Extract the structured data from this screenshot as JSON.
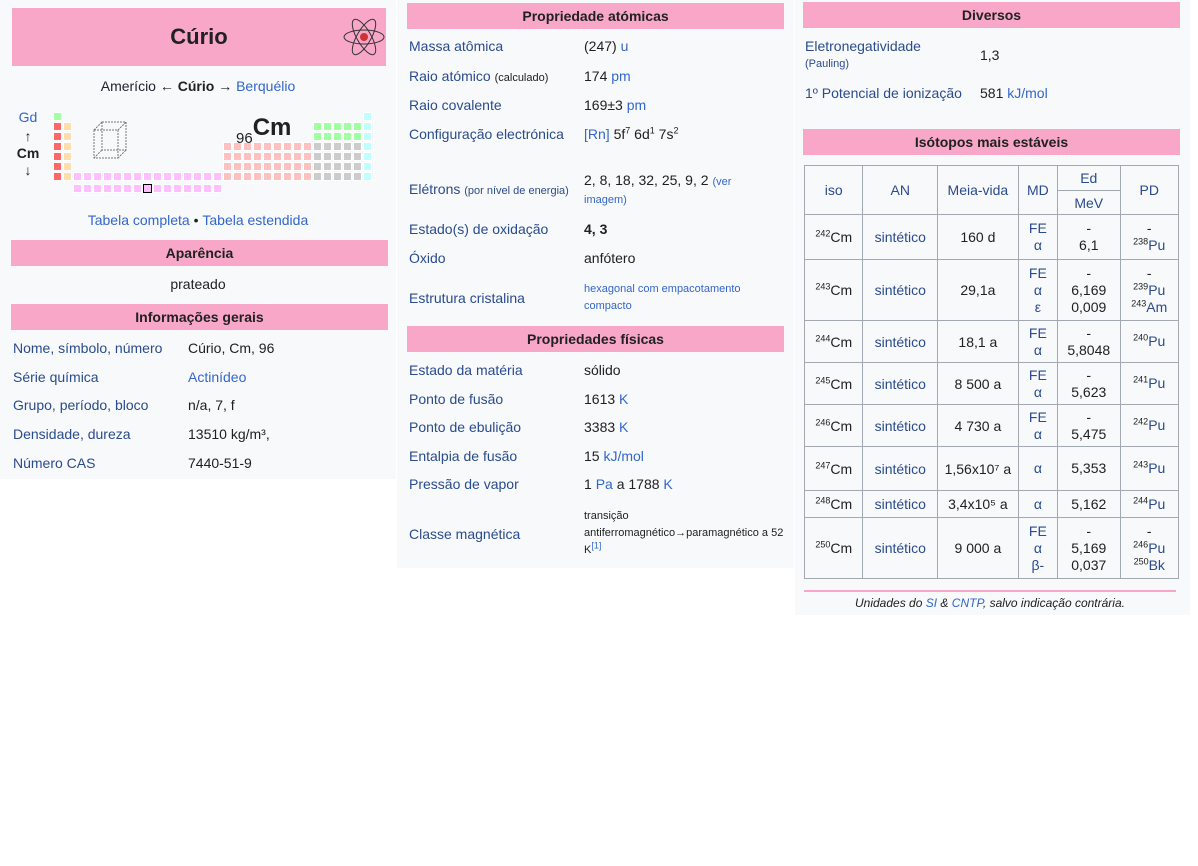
{
  "col1": {
    "title": "Cúrio",
    "nav": {
      "prev": "Amerício",
      "arrow_left": "←",
      "current": "Cúrio",
      "arrow_right": "→",
      "next": "Berquélio"
    },
    "vertical": {
      "above": "Gd",
      "up": "↑",
      "current": "Cm",
      "down": "↓"
    },
    "symbol_number": "96",
    "symbol": "Cm",
    "table_links": {
      "full": "Tabela completa",
      "sep": "•",
      "extended": "Tabela estendida"
    },
    "appearance_header": "Aparência",
    "appearance_value": "prateado",
    "general_header": "Informações gerais",
    "general": [
      {
        "label": "Nome, símbolo, número",
        "value": "Cúrio, Cm, 96"
      },
      {
        "label": "Série química",
        "value": "Actinídeo"
      },
      {
        "label": "Grupo, período, bloco",
        "value": "n/a, 7, f"
      },
      {
        "label": "Densidade, dureza",
        "value": "13510 kg/m³,"
      },
      {
        "label": "Número CAS",
        "value": "7440-51-9"
      }
    ]
  },
  "col2": {
    "atomic_header": "Propriedade atómicas",
    "atomic": {
      "mass_label": "Massa atômica",
      "mass_value": "(247)",
      "mass_unit": "u",
      "radius_label": "Raio atómico",
      "radius_small": "(calculado)",
      "radius_value": "174",
      "radius_unit": "pm",
      "cov_label": "Raio covalente",
      "cov_value": "169±3",
      "cov_unit": "pm",
      "config_label": "Configuração electrónica",
      "config_rn": "[Rn]",
      "electrons_label": "Elétrons",
      "electrons_small": "(por nível de energia)",
      "electrons_value": "2, 8, 18, 32, 25, 9, 2",
      "electrons_link": "(ver imagem)",
      "ox_label": "Estado(s) de oxidação",
      "ox_value": "4, 3",
      "oxide_label": "Óxido",
      "oxide_value": "anfótero",
      "crystal_label": "Estrutura cristalina",
      "crystal_value": "hexagonal com empacotamento compacto"
    },
    "physical_header": "Propriedades físicas",
    "physical": {
      "state_label": "Estado da matéria",
      "state_value": "sólido",
      "melt_label": "Ponto de fusão",
      "melt_value": "1613",
      "melt_unit": "K",
      "boil_label": "Ponto de ebulição",
      "boil_value": "3383",
      "boil_unit": "K",
      "enth_label": "Entalpia de fusão",
      "enth_value": "15",
      "enth_unit": "kJ/mol",
      "vap_label": "Pressão de vapor",
      "vap_value": "1",
      "vap_unit": "Pa",
      "vap_at": "a 1788",
      "vap_unit2": "K",
      "mag_label": "Classe magnética",
      "mag_value": "transição antiferromagnético→paramagnético a 52 K",
      "mag_ref": "[1]"
    }
  },
  "col3": {
    "misc_header": "Diversos",
    "eneg_label": "Eletronegatividade",
    "eneg_small": "(Pauling)",
    "eneg_value": "1,3",
    "ion_label": "1º Potencial de ionização",
    "ion_value": "581",
    "ion_unit": "kJ/mol",
    "iso_header": "Isótopos mais estáveis",
    "cols": {
      "iso": "iso",
      "an": "AN",
      "half": "Meia-vida",
      "md": "MD",
      "ed": "Ed",
      "mev": "MeV",
      "pd": "PD"
    },
    "isotopes": [
      {
        "mass": "242",
        "el": "Cm",
        "an": "sintético",
        "half": "160 d",
        "md": [
          "FE",
          "α"
        ],
        "ed": [
          "-",
          "6,1"
        ],
        "pd": [
          [
            "",
            "-"
          ],
          [
            "238",
            "Pu"
          ]
        ]
      },
      {
        "mass": "243",
        "el": "Cm",
        "an": "sintético",
        "half": "29,1a",
        "md": [
          "FE",
          "α",
          "ε"
        ],
        "ed": [
          "-",
          "6,169",
          "0,009"
        ],
        "pd": [
          [
            "",
            "-"
          ],
          [
            "239",
            "Pu"
          ],
          [
            "243",
            "Am"
          ]
        ]
      },
      {
        "mass": "244",
        "el": "Cm",
        "an": "sintético",
        "half": "18,1 a",
        "md": [
          "FE",
          "α"
        ],
        "ed": [
          "-",
          "5,8048"
        ],
        "pd": [
          [
            "240",
            "Pu"
          ]
        ]
      },
      {
        "mass": "245",
        "el": "Cm",
        "an": "sintético",
        "half": "8 500 a",
        "md": [
          "FE",
          "α"
        ],
        "ed": [
          "-",
          "5,623"
        ],
        "pd": [
          [
            "241",
            "Pu"
          ]
        ]
      },
      {
        "mass": "246",
        "el": "Cm",
        "an": "sintético",
        "half": "4 730 a",
        "md": [
          "FE",
          "α"
        ],
        "ed": [
          "-",
          "5,475"
        ],
        "pd": [
          [
            "242",
            "Pu"
          ]
        ]
      },
      {
        "mass": "247",
        "el": "Cm",
        "an": "sintético",
        "half": "1,56x10⁷ a",
        "md": [
          "α"
        ],
        "ed": [
          "5,353"
        ],
        "pd": [
          [
            "243",
            "Pu"
          ]
        ]
      },
      {
        "mass": "248",
        "el": "Cm",
        "an": "sintético",
        "half": "3,4x10⁵ a",
        "md": [
          "α"
        ],
        "ed": [
          "5,162"
        ],
        "pd": [
          [
            "244",
            "Pu"
          ]
        ]
      },
      {
        "mass": "250",
        "el": "Cm",
        "an": "sintético",
        "half": "9 000 a",
        "md": [
          "FE",
          "α",
          "β-"
        ],
        "ed": [
          "-",
          "5,169",
          "0,037"
        ],
        "pd": [
          [
            "",
            "-"
          ],
          [
            "246",
            "Pu"
          ],
          [
            "250",
            "Bk"
          ]
        ]
      }
    ],
    "footer": {
      "pre": "Unidades do",
      "si": "SI",
      "amp": "&",
      "cntp": "CNTP",
      "post": ", salvo indicação contrária."
    }
  },
  "colors": {
    "header": "#f9a7c9",
    "link": "#3366cc",
    "label": "#2a4b8d"
  }
}
